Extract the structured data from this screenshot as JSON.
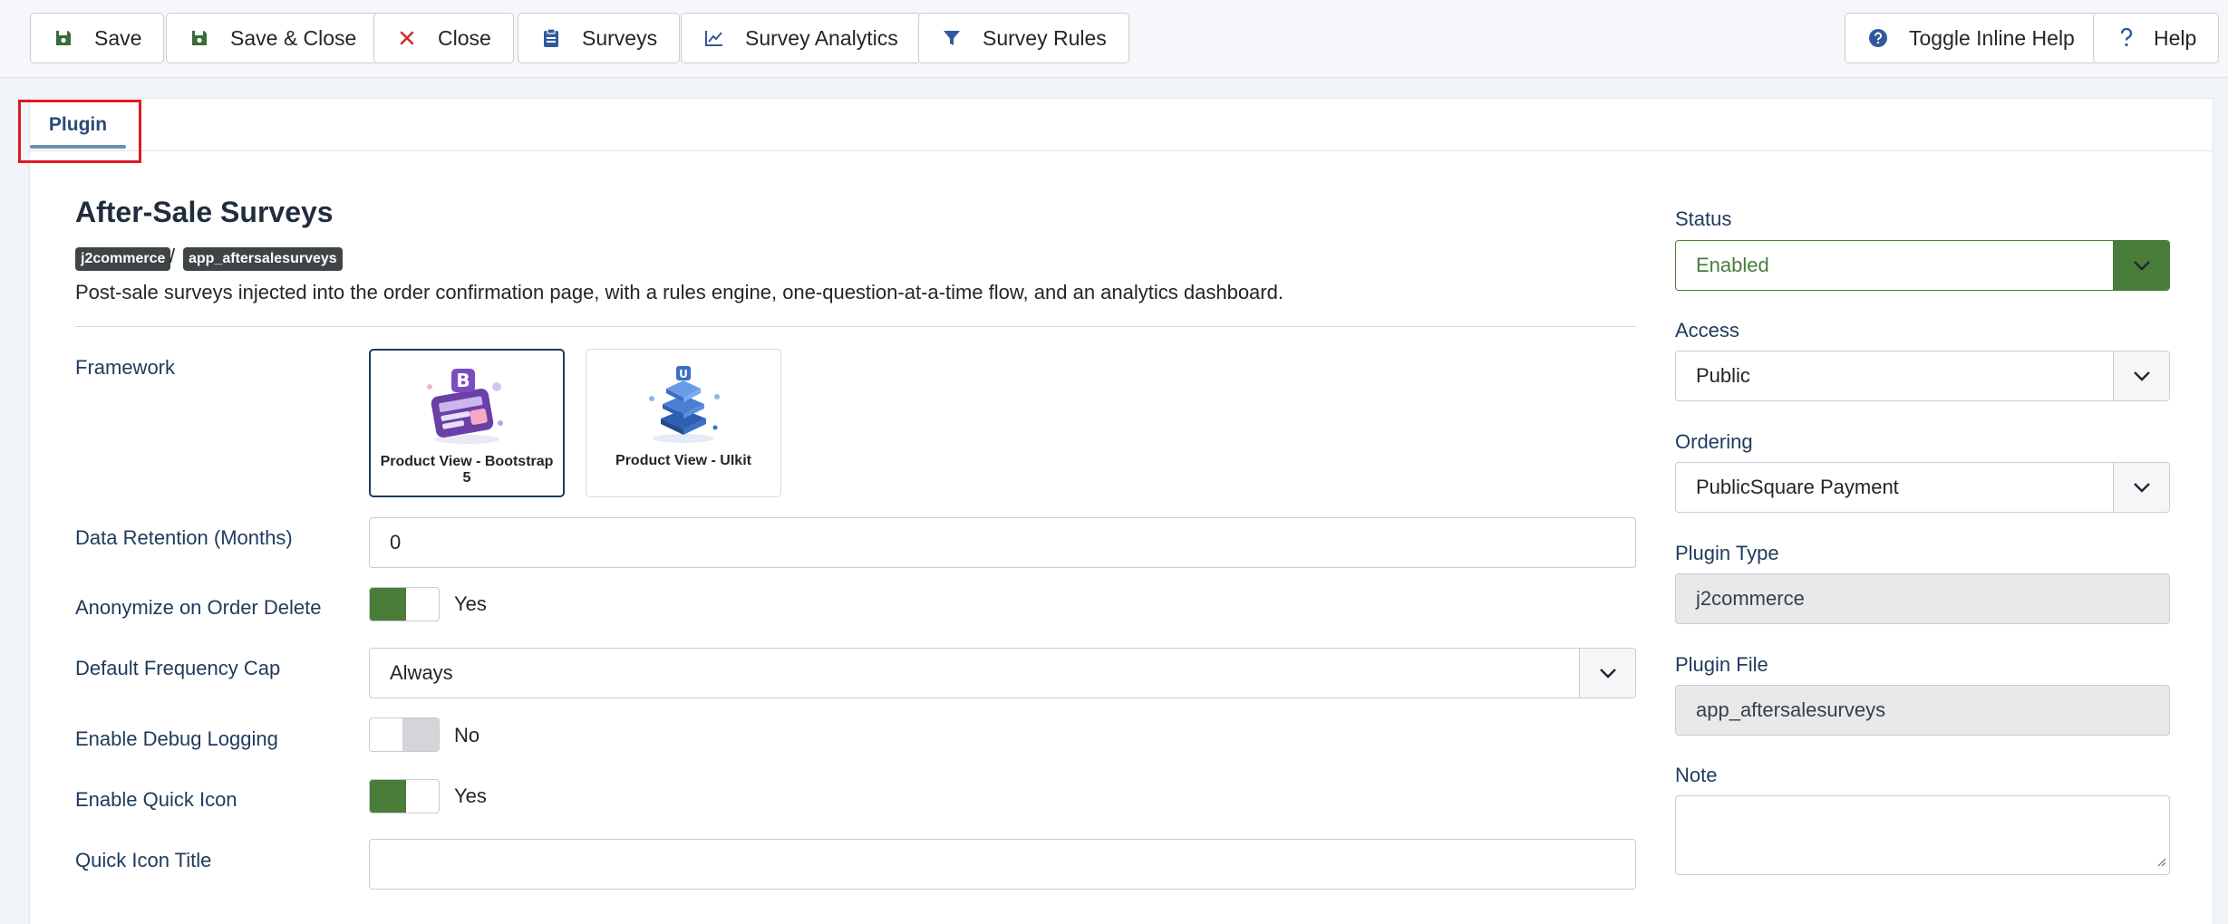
{
  "toolbar": {
    "save": "Save",
    "save_close": "Save & Close",
    "close": "Close",
    "surveys": "Surveys",
    "survey_analytics": "Survey Analytics",
    "survey_rules": "Survey Rules",
    "toggle_inline_help": "Toggle Inline Help",
    "help": "Help"
  },
  "tabs": {
    "plugin": "Plugin"
  },
  "extension": {
    "title": "After-Sale Surveys",
    "group": "j2commerce",
    "separator": "/",
    "element": "app_aftersalesurveys",
    "description": "Post-sale surveys injected into the order confirmation page, with a rules engine, one-question-at-a-time flow, and an analytics dashboard."
  },
  "form": {
    "framework": {
      "label": "Framework",
      "options": [
        {
          "name": "Product View - Bootstrap 5",
          "selected": true
        },
        {
          "name": "Product View - UIkit",
          "selected": false
        }
      ]
    },
    "data_retention": {
      "label": "Data Retention (Months)",
      "value": "0"
    },
    "anonymize": {
      "label": "Anonymize on Order Delete",
      "state": "Yes"
    },
    "frequency_cap": {
      "label": "Default Frequency Cap",
      "value": "Always"
    },
    "debug_logging": {
      "label": "Enable Debug Logging",
      "state": "No"
    },
    "quick_icon": {
      "label": "Enable Quick Icon",
      "state": "Yes"
    },
    "quick_icon_title": {
      "label": "Quick Icon Title",
      "value": ""
    }
  },
  "sidebar": {
    "status": {
      "label": "Status",
      "value": "Enabled"
    },
    "access": {
      "label": "Access",
      "value": "Public"
    },
    "ordering": {
      "label": "Ordering",
      "value": "PublicSquare Payment"
    },
    "plugin_type": {
      "label": "Plugin Type",
      "value": "j2commerce"
    },
    "plugin_file": {
      "label": "Plugin File",
      "value": "app_aftersalesurveys"
    },
    "note": {
      "label": "Note",
      "value": ""
    }
  },
  "colors": {
    "toggle_on": "#4a7c3a",
    "toggle_off": "#d3d5d8",
    "status_enabled": "#4a7c3a",
    "link_label": "#1f3a5c",
    "icon_blue": "#2f5a9e",
    "close_red": "#c9302c",
    "annotation_red": "#e0191f"
  },
  "icons": {
    "save": "floppy-disk-icon",
    "save_close": "floppy-disk-icon",
    "close": "close-icon",
    "surveys": "clipboard-icon",
    "survey_analytics": "line-chart-icon",
    "survey_rules": "filter-icon",
    "toggle_inline_help": "question-circle-icon",
    "help": "question-icon"
  }
}
